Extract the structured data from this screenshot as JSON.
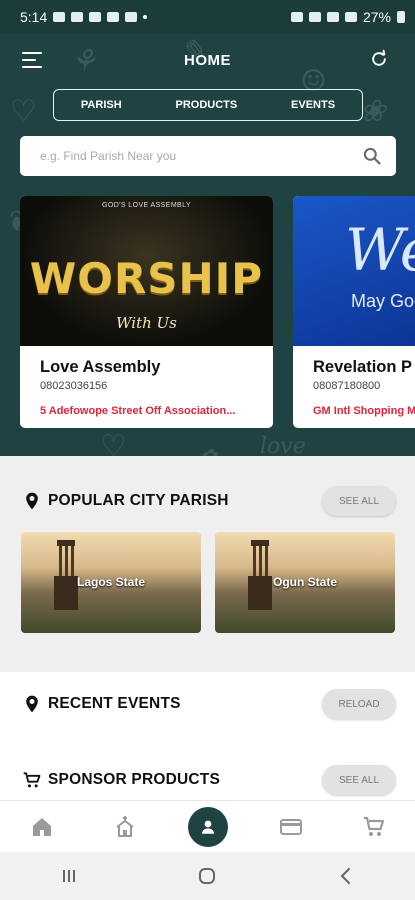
{
  "status_bar": {
    "time": "5:14",
    "battery": "27%"
  },
  "header": {
    "title": "HOME"
  },
  "tabs": [
    {
      "label": "PARISH"
    },
    {
      "label": "PRODUCTS"
    },
    {
      "label": "EVENTS"
    }
  ],
  "search": {
    "placeholder": "e.g. Find Parish Near you",
    "value": ""
  },
  "featured_parishes": [
    {
      "name": "Love Assembly",
      "phone": "08023036156",
      "address": "5 Adefowope Street Off Association...",
      "image_text": {
        "banner_small": "GOD'S LOVE ASSEMBLY",
        "headline": "WORSHIP",
        "sub": "With Us"
      }
    },
    {
      "name": "Revelation P",
      "phone": "08087180800",
      "address": "GM Intl Shopping M",
      "image_text": {
        "headline": "Wel",
        "sub": "May God"
      }
    }
  ],
  "popular_city": {
    "title": "POPULAR CITY PARISH",
    "see_all": "SEE ALL",
    "cities": [
      {
        "label": "Lagos State"
      },
      {
        "label": "Ogun State"
      }
    ]
  },
  "recent_events": {
    "title": "RECENT EVENTS",
    "reload": "RELOAD"
  },
  "sponsor_products": {
    "title": "SPONSOR PRODUCTS",
    "see_all": "SEE ALL"
  },
  "bottom_nav": [
    {
      "icon": "home-icon"
    },
    {
      "icon": "church-icon"
    },
    {
      "icon": "profile-icon"
    },
    {
      "icon": "card-icon"
    },
    {
      "icon": "cart-icon"
    }
  ],
  "colors": {
    "primary": "#1f4343",
    "accent_red": "#e0243a",
    "background": "#efefef"
  }
}
